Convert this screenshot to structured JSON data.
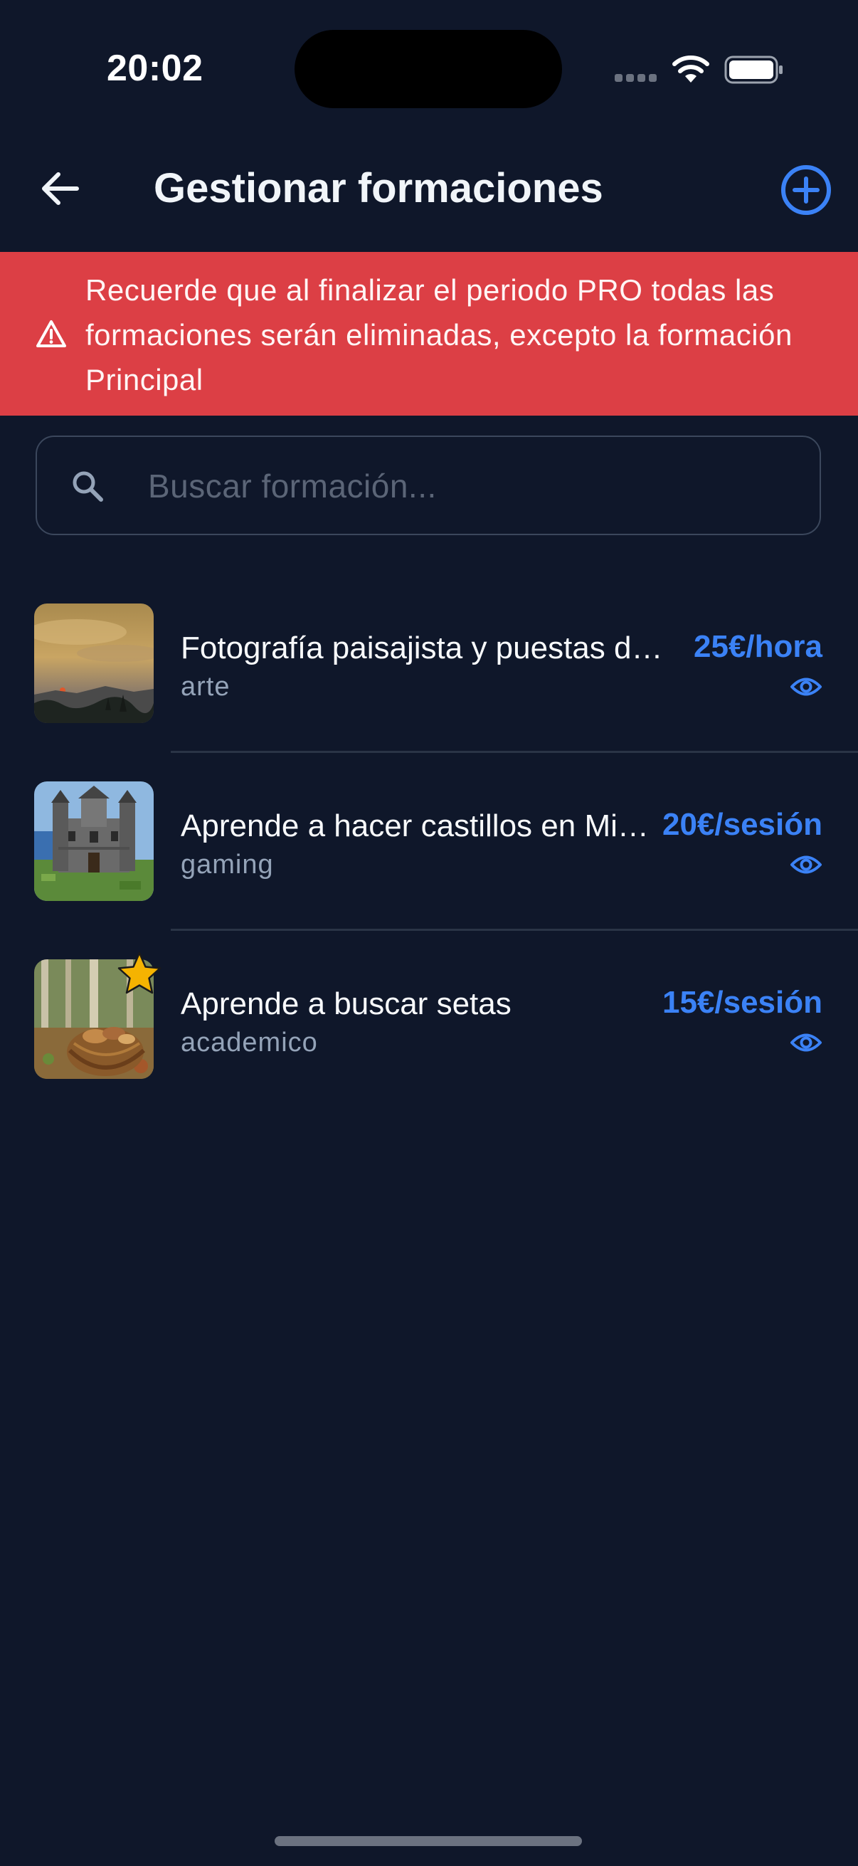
{
  "status_bar": {
    "time": "20:02"
  },
  "header": {
    "title": "Gestionar formaciones",
    "back_icon": "arrow-left-icon",
    "add_icon": "plus-circle-icon"
  },
  "warning": {
    "icon": "warning-triangle-icon",
    "text": "Recuerde que al finalizar el periodo PRO todas las formaciones serán eliminadas, excepto la formación Principal",
    "background": "#dc3f45"
  },
  "search": {
    "placeholder": "Buscar formación...",
    "value": ""
  },
  "trainings": [
    {
      "title": "Fotografía paisajista y puestas de sol",
      "category": "arte",
      "price": "25€/hora",
      "principal": false,
      "thumbnail": "sunset-landscape"
    },
    {
      "title": "Aprende a hacer castillos en Minecraft",
      "category": "gaming",
      "price": "20€/sesión",
      "principal": false,
      "thumbnail": "minecraft-castle"
    },
    {
      "title": "Aprende a buscar setas",
      "category": "academico",
      "price": "15€/sesión",
      "principal": true,
      "thumbnail": "mushroom-basket"
    }
  ],
  "colors": {
    "background": "#0f172a",
    "accent": "#3b82f6",
    "muted_text": "#94a3b8",
    "star": "#f5b301"
  }
}
